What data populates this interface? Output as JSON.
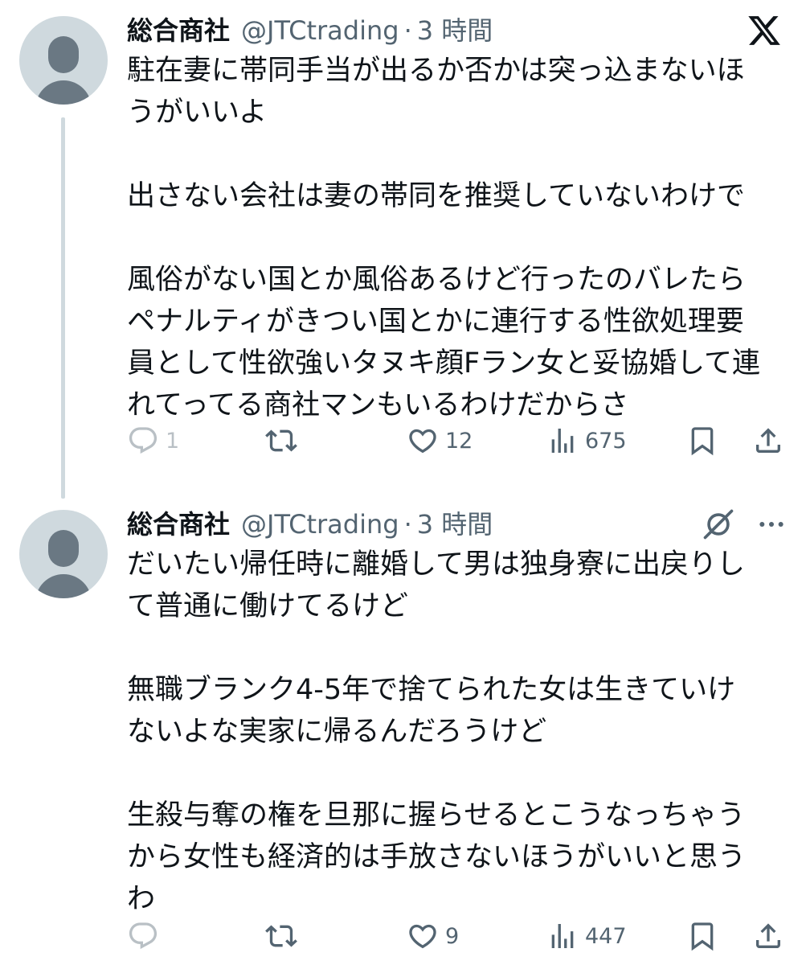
{
  "tweets": [
    {
      "display_name": "総合商社",
      "handle": "@JTCtrading",
      "separator": "·",
      "time": "3 時間",
      "text": "駐在妻に帯同手当が出るか否かは突っ込まないほ\nうがいいよ\n\n出さない会社は妻の帯同を推奨していないわけで\n\n風俗がない国とか風俗あるけど行ったのバレたら\nペナルティがきつい国とかに連行する性欲処理要\n員として性欲強いタヌキ顔Fラン女と妥協婚して連\nれてってる商社マンもいるわけだからさ",
      "stats": {
        "replies": "1",
        "retweets": "",
        "likes": "12",
        "views": "675"
      }
    },
    {
      "display_name": "総合商社",
      "handle": "@JTCtrading",
      "separator": "·",
      "time": "3 時間",
      "text": "だいたい帰任時に離婚して男は独身寮に出戻りし\nて普通に働けてるけど\n\n無職ブランク4-5年で捨てられた女は生きていけ\nないよな実家に帰るんだろうけど\n\n生殺与奪の権を旦那に握らせるとこうなっちゃう\nから女性も経済的は手放さないほうがいいと思う\nわ",
      "stats": {
        "replies": "",
        "retweets": "",
        "likes": "9",
        "views": "447"
      }
    }
  ],
  "icons": {
    "brand": "x-logo-icon",
    "reply": "reply-icon",
    "retweet": "retweet-icon",
    "like": "heart-icon",
    "views": "views-icon",
    "bookmark": "bookmark-icon",
    "share": "share-icon",
    "grok": "grok-icon",
    "more": "more-icon"
  },
  "colors": {
    "text_primary": "#0f1419",
    "text_secondary": "#536471",
    "avatar_bg": "#cfd9de",
    "avatar_fg": "#6a7883",
    "thread_line": "#cfd9de"
  }
}
